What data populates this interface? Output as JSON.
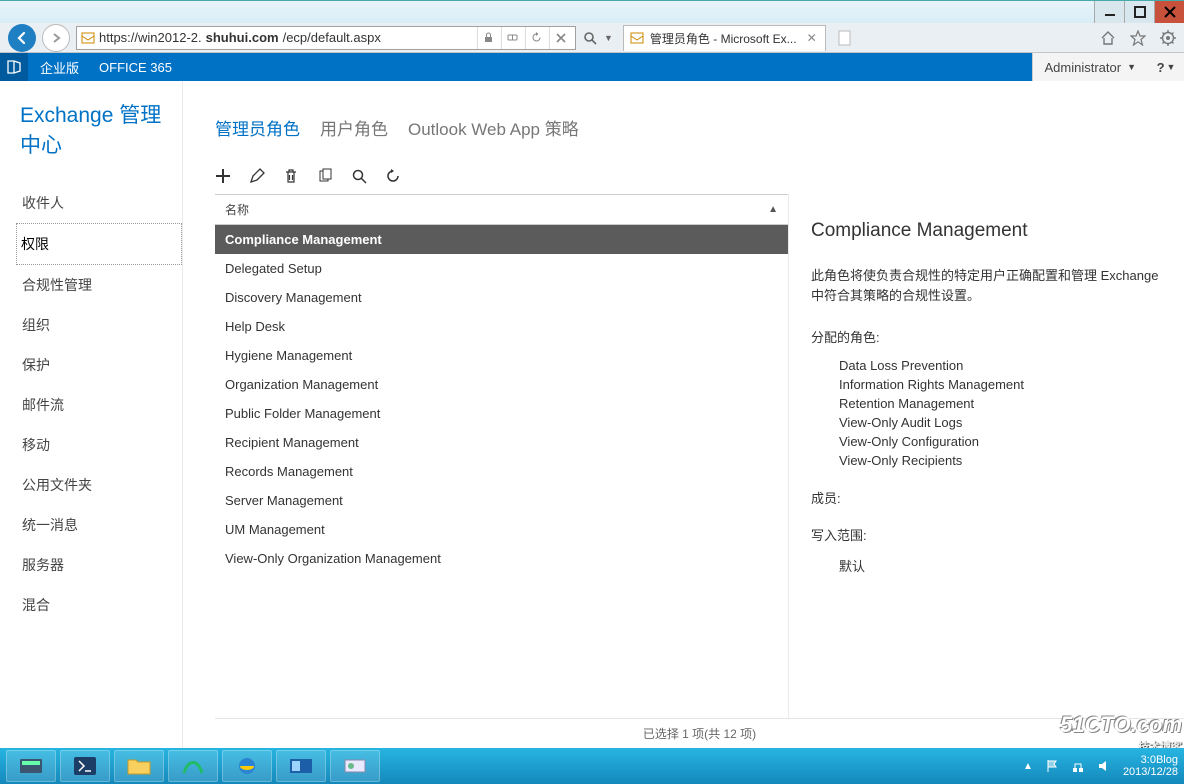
{
  "window": {
    "url_prefix": "https://win2012-2.",
    "url_domain": "shuhui.com",
    "url_path": "/ecp/default.aspx",
    "tab_title": "管理员角色 - Microsoft Ex..."
  },
  "o365": {
    "brand": "企业版",
    "product": "OFFICE 365",
    "user": "Administrator"
  },
  "eac": {
    "title": "Exchange 管理中心",
    "nav": [
      {
        "label": "收件人"
      },
      {
        "label": "权限",
        "selected": true
      },
      {
        "label": "合规性管理"
      },
      {
        "label": "组织"
      },
      {
        "label": "保护"
      },
      {
        "label": "邮件流"
      },
      {
        "label": "移动"
      },
      {
        "label": "公用文件夹"
      },
      {
        "label": "统一消息"
      },
      {
        "label": "服务器"
      },
      {
        "label": "混合"
      }
    ],
    "tabs": [
      {
        "label": "管理员角色",
        "active": true
      },
      {
        "label": "用户角色"
      },
      {
        "label": "Outlook Web App 策略"
      }
    ],
    "col_header": "名称",
    "roles": [
      {
        "label": "Compliance Management",
        "selected": true
      },
      {
        "label": "Delegated Setup"
      },
      {
        "label": "Discovery Management"
      },
      {
        "label": "Help Desk"
      },
      {
        "label": "Hygiene Management"
      },
      {
        "label": "Organization Management"
      },
      {
        "label": "Public Folder Management"
      },
      {
        "label": "Recipient Management"
      },
      {
        "label": "Records Management"
      },
      {
        "label": "Server Management"
      },
      {
        "label": "UM Management"
      },
      {
        "label": "View-Only Organization Management"
      }
    ],
    "status": "已选择 1 项(共 12 项)",
    "detail": {
      "title": "Compliance Management",
      "desc": "此角色将使负责合规性的特定用户正确配置和管理 Exchange 中符合其策略的合规性设置。",
      "assigned_label": "分配的角色:",
      "assigned": [
        "Data Loss Prevention",
        "Information Rights Management",
        "Retention Management",
        "View-Only Audit Logs",
        "View-Only Configuration",
        "View-Only Recipients"
      ],
      "members_label": "成员:",
      "scope_label": "写入范围:",
      "scope_value": "默认"
    }
  },
  "taskbar": {
    "time": "3:0",
    "tag": "Blog",
    "date": "2013/12/28"
  },
  "watermark": {
    "big": "51CTO.com",
    "small": "技术博客"
  }
}
